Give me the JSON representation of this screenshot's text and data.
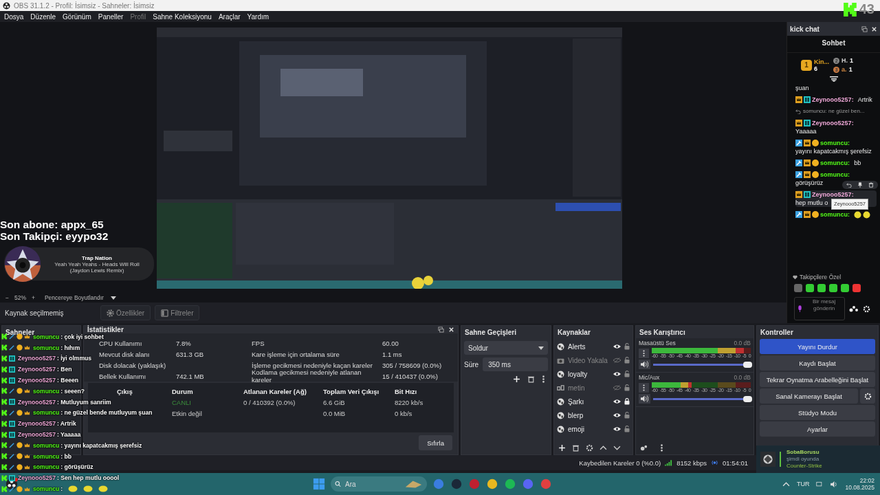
{
  "window": {
    "title": "OBS 31.1.2 - Profil: İsimsiz - Sahneler: İsimsiz",
    "badge": "43"
  },
  "menu": [
    {
      "label": "Dosya",
      "disabled": false
    },
    {
      "label": "Düzenle",
      "disabled": false
    },
    {
      "label": "Görünüm",
      "disabled": false
    },
    {
      "label": "Paneller",
      "disabled": false
    },
    {
      "label": "Profil",
      "disabled": true
    },
    {
      "label": "Sahne Koleksiyonu",
      "disabled": false
    },
    {
      "label": "Araçlar",
      "disabled": false
    },
    {
      "label": "Yardım",
      "disabled": false
    }
  ],
  "overlay": {
    "subscriber": "Son abone: appx_65",
    "follower": "Son Takipçi: eyypo32",
    "music_title": "Trap Nation",
    "music_song": "Yeah Yeah Yeahs - Heads Will Roll (Jaydon Lewis Remix)"
  },
  "zoom_bar": {
    "minus": "−",
    "zoom": "52%",
    "plus": "+",
    "mode": "Pencereye Boyutlandır"
  },
  "source_toolbar": {
    "status": "Kaynak seçilmemiş",
    "buttons": [
      "Özellikler",
      "Filtreler"
    ]
  },
  "chat_dock": {
    "title": "kick chat",
    "header": "Sohbet",
    "leaders": [
      {
        "name": "Kin...",
        "count": "6",
        "rank": "1"
      },
      {
        "name": "H.",
        "count": "1",
        "rank": "2"
      },
      {
        "name": "a.",
        "count": "1",
        "rank": "3"
      }
    ],
    "messages": [
      {
        "kind": "text",
        "text": "şuan"
      },
      {
        "kind": "message",
        "user": "Zeynooo5257:",
        "text": "Artrik",
        "color": "#f0a8d8"
      },
      {
        "kind": "reply",
        "text": "somuncu: ne güzel ben..."
      },
      {
        "kind": "message",
        "user": "Zeynooo5257:",
        "text": "Yaaaaa",
        "color": "#f0a8d8"
      },
      {
        "kind": "message",
        "user": "somuncu:",
        "text": "yayını kapatcakmış şerefsiz",
        "color": "#53fc18"
      },
      {
        "kind": "message",
        "user": "somuncu:",
        "text": "bb",
        "color": "#53fc18"
      },
      {
        "kind": "message",
        "user": "somuncu:",
        "text": "görüşürüz",
        "color": "#53fc18"
      },
      {
        "kind": "message",
        "user": "Zeynooo5257:",
        "text": "hep mutlu o",
        "color": "#f0a8d8"
      },
      {
        "kind": "emotes",
        "user": "somuncu:",
        "color": "#53fc18"
      }
    ],
    "tooltip": "Zeynooo5257",
    "followers_only": "Takipçilere Özel",
    "placeholder": "Bir mesaj gönderin"
  },
  "overlay_chat": [
    {
      "user": "somuncu",
      "text": ": çok iyi sohbet",
      "color": "#53fc18",
      "kind": "text"
    },
    {
      "user": "somuncu",
      "text": ": hıhım",
      "color": "#53fc18",
      "kind": "text"
    },
    {
      "user": "Zeynooo5257",
      "text": ": İyi olmmus",
      "color": "#f0a8d8",
      "kind": "text"
    },
    {
      "user": "Zeynooo5257",
      "text": ": Ben",
      "color": "#f0a8d8",
      "kind": "text"
    },
    {
      "user": "Zeynooo5257",
      "text": ": Beeen",
      "color": "#f0a8d8",
      "kind": "text"
    },
    {
      "user": "somuncu",
      "text": ": seeen?",
      "color": "#53fc18",
      "kind": "text"
    },
    {
      "user": "Zeynooo5257",
      "text": ": Mutluyum sanriim",
      "color": "#f0a8d8",
      "kind": "text"
    },
    {
      "user": "somuncu",
      "text": ": ne güzel bende mutluyum şuan",
      "color": "#53fc18",
      "kind": "text"
    },
    {
      "user": "Zeynooo5257",
      "text": ": Artrik",
      "color": "#f0a8d8",
      "kind": "text"
    },
    {
      "user": "Zeynooo5257",
      "text": ": Yaaaaa",
      "color": "#f0a8d8",
      "kind": "text"
    },
    {
      "user": "somuncu",
      "text": ": yayını kapatcakmış şerefsiz",
      "color": "#53fc18",
      "kind": "text"
    },
    {
      "user": "somuncu",
      "text": ": bb",
      "color": "#53fc18",
      "kind": "text"
    },
    {
      "user": "somuncu",
      "text": ": görüşürüz",
      "color": "#53fc18",
      "kind": "text"
    },
    {
      "user": "Zeynooo5257",
      "text": ": Sen hep mutlu ooool",
      "color": "#f0a8d8",
      "kind": "text"
    },
    {
      "user": "somuncu",
      "text": ":",
      "color": "#53fc18",
      "kind": "emotes"
    }
  ],
  "scenes": {
    "title": "Sahneler"
  },
  "stats": {
    "title": "İstatistikler",
    "left": [
      {
        "label": "CPU Kullanımı",
        "value": "7.8%"
      },
      {
        "label": "Mevcut disk alanı",
        "value": "631.3 GB"
      },
      {
        "label": "Disk dolacak (yaklaşık)"
      },
      {
        "label": "Bellek Kullanımı",
        "value": "742.1 MB"
      }
    ],
    "right": [
      {
        "label": "FPS",
        "value": "60.00"
      },
      {
        "label": "Kare işleme için ortalama süre",
        "value": "1.1 ms"
      },
      {
        "label": "İşleme gecikmesi nedeniyle kaçan kareler",
        "value": "305 / 758609 (0.0%)"
      },
      {
        "label": "Kodlama gecikmesi nedeniyle atlanan kareler",
        "value": "15 / 410437 (0.0%)"
      }
    ],
    "columns": [
      "Çıkış",
      "Durum",
      "Atlanan Kareler (Ağ)",
      "Toplam Veri Çıkışı",
      "Bit Hızı"
    ],
    "rows": [
      {
        "status": "CANLI",
        "live": true,
        "skipped": "0 / 410392 (0.0%)",
        "total": "6.6 GiB",
        "bitrate": "8220 kb/s"
      },
      {
        "status": "Etkin değil",
        "live": false,
        "total": "0.0 MiB",
        "bitrate": "0 kb/s"
      }
    ],
    "reset": "Sıfırla"
  },
  "transitions": {
    "title": "Sahne Geçişleri",
    "transition": "Soldur",
    "duration_label": "Süre",
    "duration": "350 ms"
  },
  "sources": {
    "title": "Kaynaklar",
    "items": [
      {
        "name": "Alerts",
        "kind": "browser",
        "visible": true,
        "locked": false
      },
      {
        "name": "Video Yakala",
        "kind": "camera",
        "visible": false,
        "locked": false
      },
      {
        "name": "loyalty",
        "kind": "browser",
        "visible": true,
        "locked": false
      },
      {
        "name": "metin",
        "kind": "text",
        "visible": false,
        "locked": false
      },
      {
        "name": "Şarkı",
        "kind": "browser",
        "visible": true,
        "locked": true
      },
      {
        "name": "blerp",
        "kind": "browser",
        "visible": true,
        "locked": false
      },
      {
        "name": "emoji",
        "kind": "browser",
        "visible": true,
        "locked": false
      }
    ]
  },
  "mixer": {
    "title": "Ses Karıştırıcı",
    "channels": [
      {
        "name": "Masaüstü Ses",
        "reading": "0.0 dB",
        "level": 0.93,
        "volume": {
          "level": 1.0
        },
        "ticks": [
          "-60",
          "-55",
          "-50",
          "-45",
          "-40",
          "-35",
          "-30",
          "-25",
          "-20",
          "-15",
          "-10",
          "-5",
          "0"
        ]
      },
      {
        "name": "Mic/Aux",
        "reading": "0.0 dB",
        "level": 0.4,
        "volume": {
          "level": 1.0
        },
        "ticks": [
          "-60",
          "-55",
          "-50",
          "-45",
          "-40",
          "-35",
          "-30",
          "-25",
          "-20",
          "-15",
          "-10",
          "-5",
          "0"
        ]
      }
    ]
  },
  "controls": {
    "title": "Kontroller",
    "buttons": [
      {
        "label": "Yayını Durdur",
        "active": true,
        "kind": "plain"
      },
      {
        "label": "Kaydı Başlat",
        "active": false,
        "kind": "plain"
      },
      {
        "label": "Tekrar Oynatma Arabelleğini Başlat",
        "active": false,
        "kind": "plain"
      },
      {
        "label": "Sanal Kamerayı Başlat",
        "active": false,
        "kind": "gear"
      },
      {
        "label": "Stüdyo Modu",
        "active": false,
        "kind": "plain"
      },
      {
        "label": "Ayarlar",
        "active": false,
        "kind": "plain"
      }
    ]
  },
  "status_bar": {
    "dropped": "Kaybedilen Kareler 0 (%0.0)",
    "bitrate": "8152 kbps",
    "time": "01:54:01"
  },
  "notification": {
    "name": "SobaBorusu",
    "status": "şimdi oyunda",
    "game": "Counter-Strike"
  },
  "taskbar": {
    "search": {
      "placeholder": "Ara"
    },
    "language": "TUR",
    "time": "22:02",
    "date": "10.08.2025"
  }
}
